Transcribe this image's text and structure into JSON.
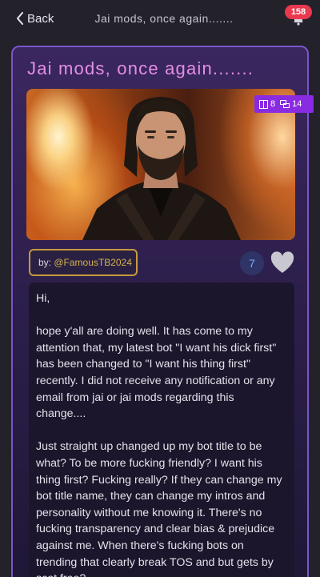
{
  "topbar": {
    "back_label": "Back",
    "title": "Jai mods, once again.......",
    "notification_count": "158"
  },
  "post": {
    "title": "Jai mods, once again.......",
    "stats": {
      "images": "8",
      "comments": "14"
    },
    "author_prefix": "by: ",
    "author_handle": "@FamousTB2024",
    "count": "7",
    "body": "Hi,\n\nhope y'all are doing well. It has come to my attention that, my latest bot \"I want his dick first\" has been changed to \"I want his thing first\" recently. I did not receive any notification or any email from jai or jai mods regarding this change....\n\nJust straight up changed up my bot title to be what? To be more fucking friendly? I want his thing first? Fucking really? If they can change my bot title name, they can change my intros and personality without me knowing it. There's no fucking transparency and clear bias & prejudice against me. When there's fucking bots on trending that clearly break TOS and but gets by scot free?\n\nJai mods are not just moderating images (which"
  },
  "colors": {
    "accent_title": "#e58fe4",
    "card_border": "#7b55c9",
    "badge_red": "#e8394f",
    "stats_purple": "#8a2be2",
    "author_gold": "#c79a3d"
  },
  "icons": {
    "back": "chevron-left-icon",
    "notification": "bell-icon",
    "images": "image-stack-icon",
    "comments": "chat-icon",
    "favorite": "heart-icon"
  }
}
